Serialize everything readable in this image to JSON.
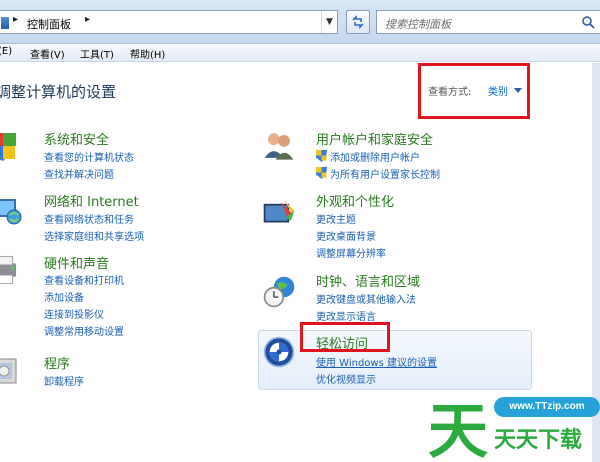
{
  "address": {
    "breadcrumb": "控制面板",
    "search_placeholder": "搜索控制面板"
  },
  "menu": {
    "edit": "(E)",
    "view": "查看(V)",
    "tools": "工具(T)",
    "help": "帮助(H)"
  },
  "page": {
    "title": "调整计算机的设置",
    "view_by_label": "查看方式:",
    "view_by_value": "类别"
  },
  "categories": {
    "system": {
      "title": "系统和安全",
      "links": [
        "查看您的计算机状态",
        "查找并解决问题"
      ]
    },
    "network": {
      "title": "网络和 Internet",
      "links": [
        "查看网络状态和任务",
        "选择家庭组和共享选项"
      ]
    },
    "hardware": {
      "title": "硬件和声音",
      "links": [
        "查看设备和打印机",
        "添加设备",
        "连接到投影仪",
        "调整常用移动设置"
      ]
    },
    "programs": {
      "title": "程序",
      "links": [
        "卸载程序"
      ]
    },
    "users": {
      "title": "用户帐户和家庭安全",
      "links": [
        "添加或删除用户帐户",
        "为所有用户设置家长控制"
      ]
    },
    "appearance": {
      "title": "外观和个性化",
      "links": [
        "更改主题",
        "更改桌面背景",
        "调整屏幕分辨率"
      ]
    },
    "clock": {
      "title": "时钟、语言和区域",
      "links": [
        "更改键盘或其他输入法",
        "更改显示语言"
      ]
    },
    "ease": {
      "title": "轻松访问",
      "links": [
        "使用 Windows 建议的设置",
        "优化视频显示"
      ]
    }
  },
  "watermark": {
    "url": "www.TTzip.com",
    "name": "天天下载",
    "logo_char": "天"
  }
}
